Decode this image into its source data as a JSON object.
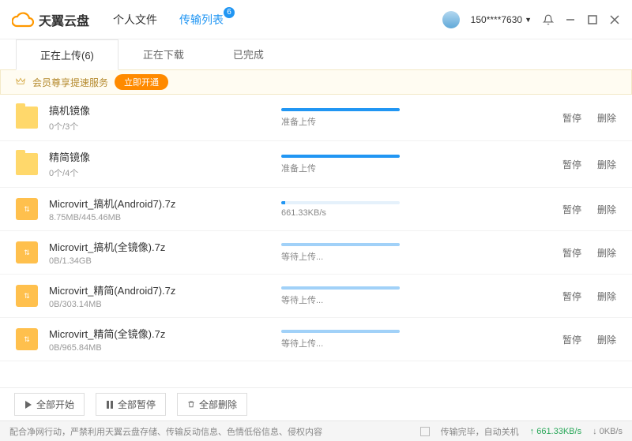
{
  "header": {
    "app_name": "天翼云盘",
    "nav": [
      {
        "label": "个人文件",
        "active": false
      },
      {
        "label": "传输列表",
        "active": true,
        "badge": "6"
      }
    ],
    "user": "150****7630"
  },
  "subtabs": [
    {
      "label": "正在上传(6)",
      "active": true
    },
    {
      "label": "正在下载",
      "active": false
    },
    {
      "label": "已完成",
      "active": false
    }
  ],
  "promo": {
    "text": "会员尊享提速服务",
    "btn": "立即开通"
  },
  "items": [
    {
      "icon": "folder",
      "name": "搞机镜像",
      "size": "0个/3个",
      "progress": 100,
      "status": "准备上传",
      "pause": "暂停",
      "del": "删除"
    },
    {
      "icon": "folder",
      "name": "精简镜像",
      "size": "0个/4个",
      "progress": 100,
      "status": "准备上传",
      "pause": "暂停",
      "del": "删除"
    },
    {
      "icon": "archive",
      "name": "Microvirt_搞机(Android7).7z",
      "size": "8.75MB/445.46MB",
      "progress": 3,
      "status": "661.33KB/s",
      "pause": "暂停",
      "del": "删除"
    },
    {
      "icon": "archive",
      "name": "Microvirt_搞机(全镜像).7z",
      "size": "0B/1.34GB",
      "progress": 100,
      "status": "等待上传...",
      "waiting": true,
      "pause": "暂停",
      "del": "删除"
    },
    {
      "icon": "archive",
      "name": "Microvirt_精简(Android7).7z",
      "size": "0B/303.14MB",
      "progress": 100,
      "status": "等待上传...",
      "waiting": true,
      "pause": "暂停",
      "del": "删除"
    },
    {
      "icon": "archive",
      "name": "Microvirt_精简(全镜像).7z",
      "size": "0B/965.84MB",
      "progress": 100,
      "status": "等待上传...",
      "waiting": true,
      "pause": "暂停",
      "del": "删除"
    }
  ],
  "bottom": {
    "start_all": "全部开始",
    "pause_all": "全部暂停",
    "delete_all": "全部删除"
  },
  "statusbar": {
    "notice": "配合净网行动，严禁利用天翼云盘存储、传输反动信息、色情低俗信息、侵权内容",
    "checkbox_label": "传输完毕，自动关机",
    "up_speed": "661.33KB/s",
    "down_speed": "0KB/s"
  }
}
